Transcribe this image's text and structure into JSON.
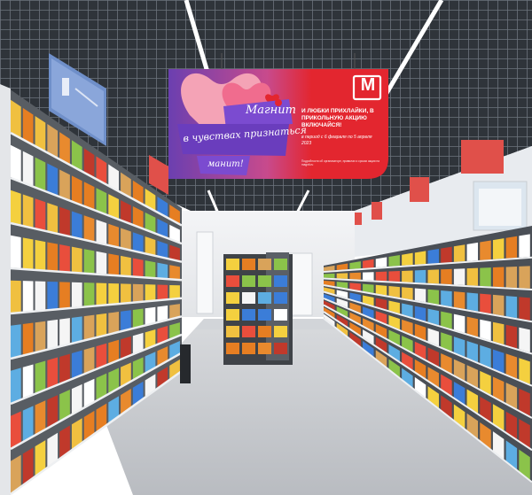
{
  "scene": {
    "description_free": true,
    "colors": {
      "ceiling": "#3a3f46",
      "ceiling_grid": "#6c737c",
      "floor": "#c9ccd0",
      "wall": "#eef0f2",
      "shelf_metal": "#dfe2e6",
      "banner_red": "#e3262f",
      "banner_purple": "#6b3fb0",
      "banner_pink": "#e8558f",
      "heart": "#f2708e",
      "sign_red": "#e0504a",
      "sign_blue": "#6f8fc9"
    }
  },
  "banner": {
    "script_line1": "Магнит",
    "script_line2": "в чувствах признаться",
    "script_line3": "манит!",
    "headline": "И ЛЮБКИ ПРИХЛАЙКИ, В ПРИКОЛЬНУЮ АКЦИЮ ВКЛЮЧАЙСЯ!",
    "dates": "в период с 6 февраля по 5 апреля 2023",
    "fineprint": "Подробности об организаторе, правилах и сроках акции на magnit.ru",
    "logo_letter": "М"
  }
}
